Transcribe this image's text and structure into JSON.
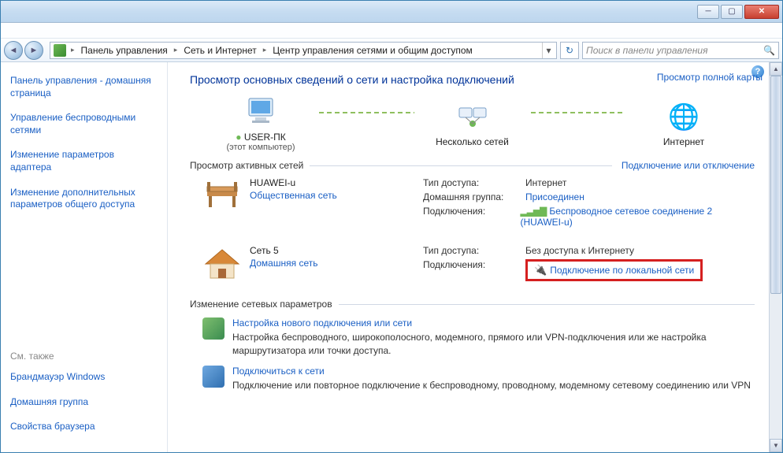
{
  "titlebar": {
    "min": "─",
    "max": "▢",
    "close": "✕"
  },
  "addr": {
    "back": "◄",
    "fwd": "►",
    "seg1": "Панель управления",
    "seg2": "Сеть и Интернет",
    "seg3": "Центр управления сетями и общим доступом",
    "dd": "▾",
    "refresh": "↻",
    "search_ph": "Поиск в панели управления",
    "mag": "🔍"
  },
  "sidebar": {
    "home": "Панель управления - домашняя страница",
    "links": [
      "Управление беспроводными сетями",
      "Изменение параметров адаптера",
      "Изменение дополнительных параметров общего доступа"
    ],
    "also_label": "См. также",
    "also": [
      "Брандмауэр Windows",
      "Домашняя группа",
      "Свойства браузера"
    ]
  },
  "help": "?",
  "main": {
    "title": "Просмотр основных сведений о сети и настройка подключений",
    "map_link": "Просмотр полной карты",
    "nodes": {
      "pc": {
        "label": "USER-ПК",
        "sub": "(этот компьютер)"
      },
      "mid": {
        "label": "Несколько сетей"
      },
      "net": {
        "label": "Интернет"
      }
    },
    "active_head": "Просмотр активных сетей",
    "active_action": "Подключение или отключение",
    "nets": [
      {
        "name": "HUAWEI-u",
        "type": "Общественная сеть",
        "access_label": "Тип доступа:",
        "access_value": "Интернет",
        "home_label": "Домашняя группа:",
        "home_value": "Присоединен",
        "conn_label": "Подключения:",
        "conn_value": "Беспроводное сетевое соединение 2 (HUAWEI-u)"
      },
      {
        "name": "Сеть  5",
        "type": "Домашняя сеть",
        "access_label": "Тип доступа:",
        "access_value": "Без доступа к Интернету",
        "conn_label": "Подключения:",
        "conn_value": "Подключение по локальной сети"
      }
    ],
    "params_head": "Изменение сетевых параметров",
    "tasks": [
      {
        "title": "Настройка нового подключения или сети",
        "desc": "Настройка беспроводного, широкополосного, модемного, прямого или VPN-подключения или же настройка маршрутизатора или точки доступа."
      },
      {
        "title": "Подключиться к сети",
        "desc": "Подключение или повторное подключение к беспроводному, проводному, модемному сетевому соединению или VPN"
      }
    ]
  }
}
